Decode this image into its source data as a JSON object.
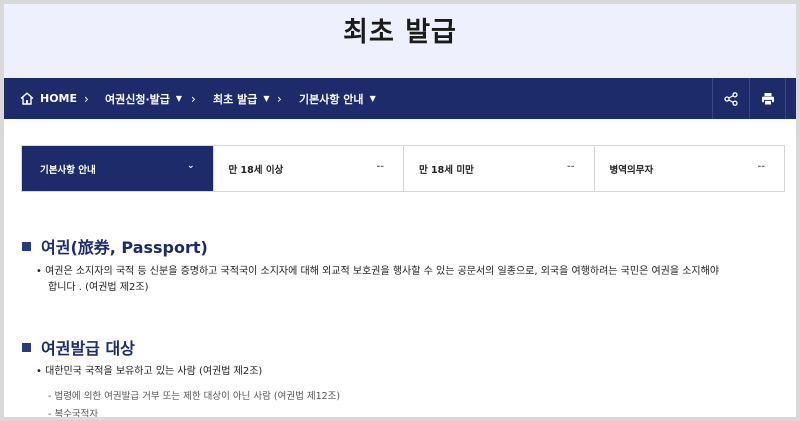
{
  "header": {
    "title": "최초 발급"
  },
  "breadcrumb": {
    "home_label": "HOME",
    "items": [
      {
        "label": "여권신청·발급",
        "caret": "▼"
      },
      {
        "label": "최초 발급",
        "caret": "▼"
      },
      {
        "label": "기본사항 안내",
        "caret": "▼"
      }
    ],
    "separator": "›"
  },
  "nav_actions": {
    "share_icon": "share-icon",
    "print_icon": "print-icon"
  },
  "tabs": [
    {
      "label": "기본사항 안내",
      "mark": "⌄",
      "active": true
    },
    {
      "label": "만 18세 이상",
      "mark": "--",
      "active": false
    },
    {
      "label": "만 18세 미만",
      "mark": "--",
      "active": false
    },
    {
      "label": "병역의무자",
      "mark": "--",
      "active": false
    }
  ],
  "sections": [
    {
      "title": "여권(旅券, Passport)",
      "line1": "• 여권은 소지자의 국적 등 신분을 증명하고 국적국이 소지자에 대해 외교적 보호권을 행사할 수 있는 공문서의 일종으로, 외국을 여행하려는 국민은 여권을 소지해야",
      "line2": "합니다 . (여권법 제2조)"
    },
    {
      "title": "여권발급 대상",
      "line1": "• 대한민국 국적을 보유하고 있는 사람 (여권법 제2조)",
      "sub1": "-  법령에 의한 여권발급 거부 또는 제한 대상이 아닌 사람 (여권법 제12조)",
      "sub2": "-  복수국적자"
    }
  ],
  "colors": {
    "navy": "#1e2b6b",
    "header_bg": "#eef0fd"
  }
}
